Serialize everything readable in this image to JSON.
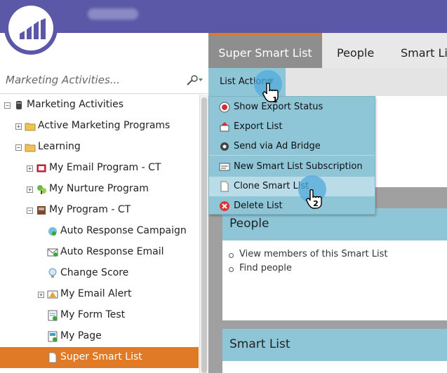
{
  "header": {
    "logo_icon": "marketo-logo-icon",
    "blurred_account": ""
  },
  "left_panel": {
    "title": "Marketing Activities...",
    "tree": [
      {
        "label": "Marketing Activities",
        "icon": "database-icon",
        "expander": "−",
        "indent": 0
      },
      {
        "label": "Active Marketing Programs",
        "icon": "folder-icon",
        "expander": "+",
        "indent": 1
      },
      {
        "label": "Learning",
        "icon": "folder-icon",
        "expander": "−",
        "indent": 1
      },
      {
        "label": "My Email Program - CT",
        "icon": "email-program-icon",
        "expander": "+",
        "indent": 2
      },
      {
        "label": "My Nurture Program",
        "icon": "nurture-program-icon",
        "expander": "+",
        "indent": 2
      },
      {
        "label": "My Program - CT",
        "icon": "program-icon",
        "expander": "−",
        "indent": 2
      },
      {
        "label": "Auto Response Campaign",
        "icon": "smart-campaign-icon",
        "expander": "",
        "indent": 3
      },
      {
        "label": "Auto Response Email",
        "icon": "email-icon",
        "expander": "",
        "indent": 3
      },
      {
        "label": "Change Score",
        "icon": "lightbulb-icon",
        "expander": "",
        "indent": 3
      },
      {
        "label": "My Email Alert",
        "icon": "email-alert-icon",
        "expander": "+",
        "indent": 3
      },
      {
        "label": "My Form Test",
        "icon": "form-icon",
        "expander": "",
        "indent": 3
      },
      {
        "label": "My Page",
        "icon": "landing-page-icon",
        "expander": "",
        "indent": 3
      },
      {
        "label": "Super Smart List",
        "icon": "smart-list-icon",
        "expander": "",
        "indent": 3,
        "selected": true
      }
    ]
  },
  "tabs": [
    {
      "label": "Super Smart List",
      "active": true
    },
    {
      "label": "People",
      "active": false
    },
    {
      "label": "Smart Lis",
      "active": false
    }
  ],
  "toolbar": {
    "list_actions_label": "List Actions"
  },
  "menu": {
    "items": [
      {
        "label": "Show Export Status",
        "icon": "export-status-icon"
      },
      {
        "label": "Export List",
        "icon": "export-list-icon"
      },
      {
        "label": "Send via Ad Bridge",
        "icon": "ad-bridge-icon"
      },
      {
        "label": "New Smart List Subscription",
        "icon": "subscription-icon"
      },
      {
        "label": "Clone Smart List",
        "icon": "clone-icon",
        "hover": true
      },
      {
        "label": "Delete List",
        "icon": "delete-icon"
      }
    ]
  },
  "cards": {
    "people": {
      "title": "People",
      "items": [
        "View members of this Smart List",
        "Find people"
      ]
    },
    "smart_list": {
      "title": "Smart List"
    }
  },
  "steps": [
    "1",
    "2"
  ],
  "colors": {
    "header": "#5b58a8",
    "selected": "#e07a26",
    "accent_blue": "#8ec6d8",
    "active_tab": "#8e8e8e"
  }
}
